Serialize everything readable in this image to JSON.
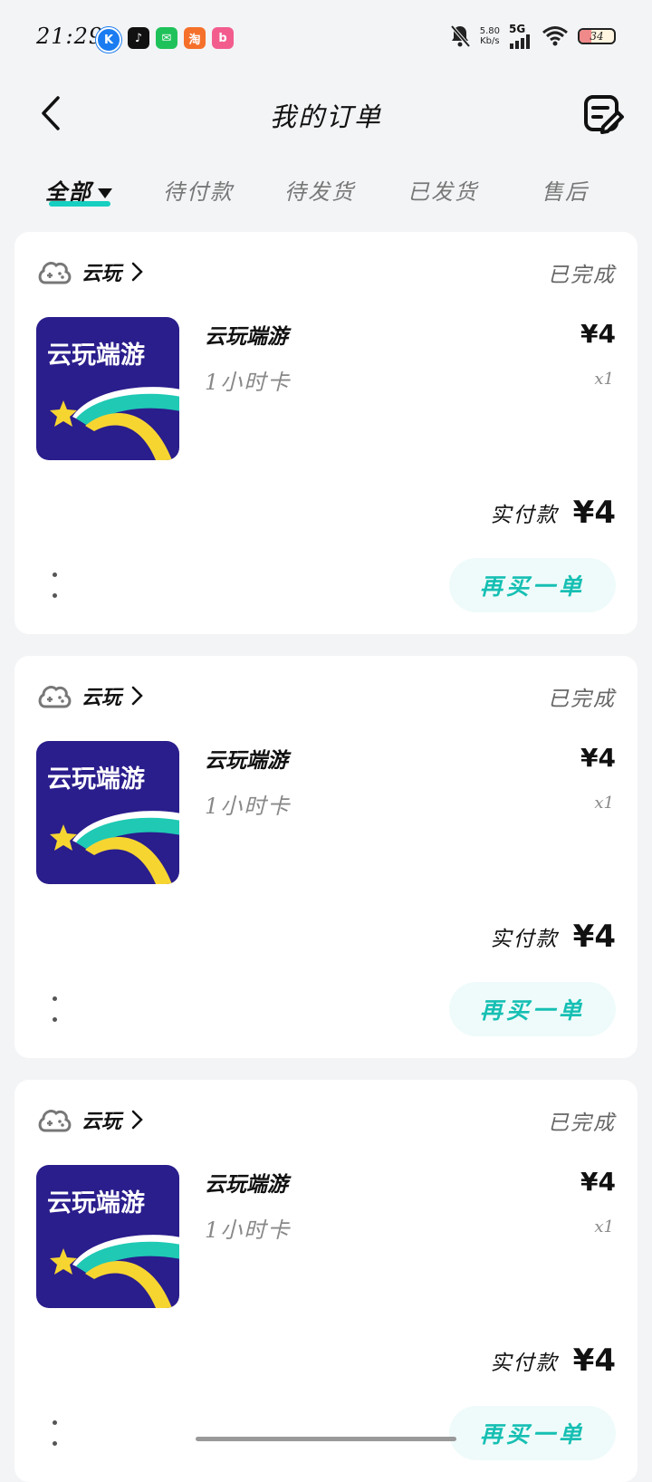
{
  "status_bar": {
    "time": "21:29",
    "app_icons": [
      {
        "name": "k-app-icon",
        "glyph": "K",
        "color": "#1a7cf0"
      },
      {
        "name": "tiktok-icon",
        "glyph": "♪",
        "color": "#111111"
      },
      {
        "name": "wechat-icon",
        "glyph": "✉",
        "color": "#1fc25a"
      },
      {
        "name": "taobao-icon",
        "glyph": "淘",
        "color": "#f5702a"
      },
      {
        "name": "bilibili-icon",
        "glyph": "b",
        "color": "#f25d8e"
      }
    ],
    "net_speed_value": "5.80",
    "net_speed_unit": "Kb/s",
    "network_type": "5G",
    "battery_level": "34",
    "battery_fraction": 0.34
  },
  "header": {
    "title": "我的订单"
  },
  "tabs": [
    {
      "label": "全部",
      "active": true
    },
    {
      "label": "待付款",
      "active": false
    },
    {
      "label": "待发货",
      "active": false
    },
    {
      "label": "已发货",
      "active": false
    },
    {
      "label": "售后",
      "active": false
    }
  ],
  "orders": [
    {
      "shop_name": "云玩",
      "status": "已完成",
      "image_title": "云玩端游",
      "product_name": "云玩端游",
      "spec": "1小时卡",
      "unit_price": "¥4",
      "quantity": "x1",
      "paid_label": "实付款",
      "paid_amount": "¥4",
      "rebuy_label": "再买一单"
    },
    {
      "shop_name": "云玩",
      "status": "已完成",
      "image_title": "云玩端游",
      "product_name": "云玩端游",
      "spec": "1小时卡",
      "unit_price": "¥4",
      "quantity": "x1",
      "paid_label": "实付款",
      "paid_amount": "¥4",
      "rebuy_label": "再买一单"
    },
    {
      "shop_name": "云玩",
      "status": "已完成",
      "image_title": "云玩端游",
      "product_name": "云玩端游",
      "spec": "1小时卡",
      "unit_price": "¥4",
      "quantity": "x1",
      "paid_label": "实付款",
      "paid_amount": "¥4",
      "rebuy_label": "再买一单"
    }
  ],
  "colors": {
    "accent": "#16cfc0",
    "product_bg": "#2a1d8c"
  }
}
